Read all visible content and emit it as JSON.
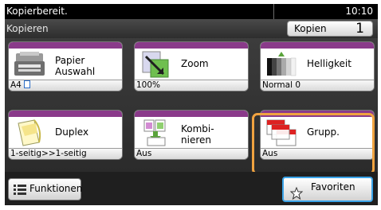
{
  "status": {
    "text": "Kopierbereit.",
    "time": "10:10"
  },
  "mode": {
    "title": "Kopieren",
    "copies_label": "Kopien",
    "copies_value": "1"
  },
  "tiles": [
    {
      "label_lines": [
        "Papier",
        "Auswahl"
      ],
      "value": "A4",
      "icon": "paper-tray-icon"
    },
    {
      "label_lines": [
        "Zoom"
      ],
      "value": "100%",
      "icon": "zoom-icon"
    },
    {
      "label_lines": [
        "Helligkeit"
      ],
      "value": "Normal 0",
      "icon": "density-icon"
    },
    {
      "label_lines": [
        "Duplex"
      ],
      "value": "1-seitig>>1-seitig",
      "icon": "duplex-icon"
    },
    {
      "label_lines": [
        "Kombi-",
        "nieren"
      ],
      "value": "Aus",
      "icon": "combine-icon"
    },
    {
      "label_lines": [
        "Grupp."
      ],
      "value": "Aus",
      "icon": "collate-icon"
    }
  ],
  "buttons": {
    "functions": "Funktionen",
    "favorites": "Favoriten"
  },
  "colors": {
    "tile_band": "#8a3a8a",
    "highlight": "#f0a340",
    "favorites_border": "#3aa3e8"
  }
}
